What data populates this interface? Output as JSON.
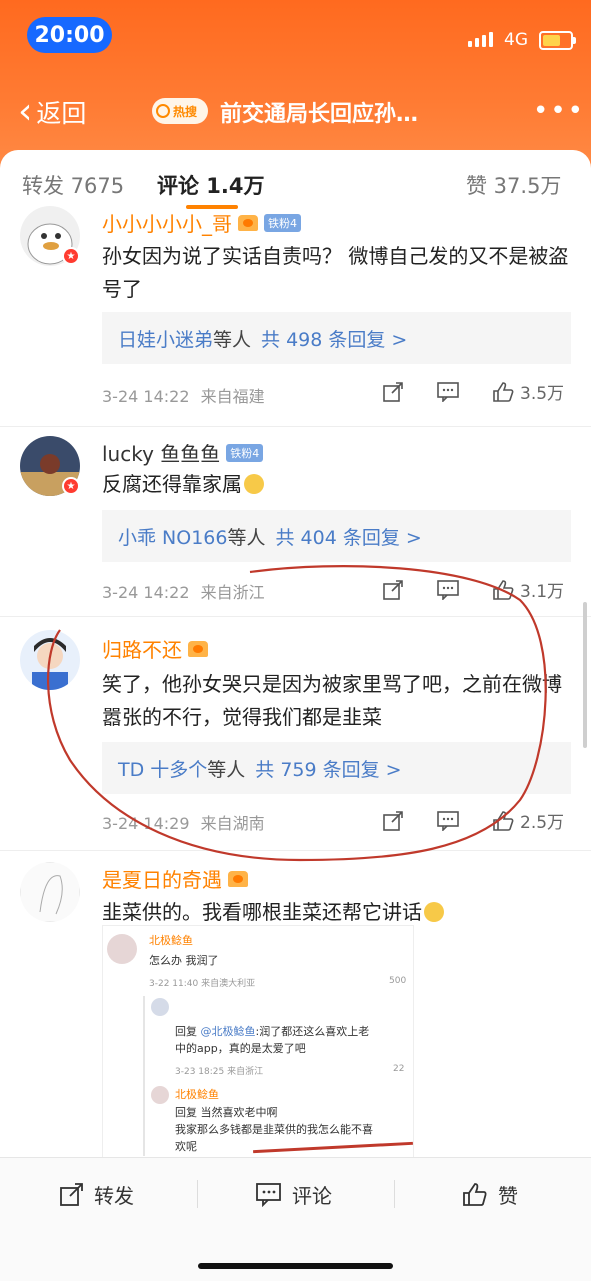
{
  "status": {
    "time": "20:00",
    "network": "4G"
  },
  "nav": {
    "back_label": "返回",
    "hot_badge": "热搜",
    "title": "前交通局长回应孙…"
  },
  "tabs": [
    {
      "label": "转发 7675"
    },
    {
      "label": "评论 1.4万"
    },
    {
      "label": "赞 37.5万"
    }
  ],
  "comments": [
    {
      "username": "小小小小小_哥",
      "fan_badge": "铁粉4",
      "text": "孙女因为说了实话自责吗？ 微博自己发的又不是被盗号了",
      "reply_names": "日娃小迷弟",
      "reply_mid": "等人",
      "reply_count": "共 498 条回复 >",
      "time": "3-24 14:22",
      "location": "来自福建",
      "likes": "3.5万"
    },
    {
      "username": "lucky 鱼鱼鱼",
      "fan_badge": "铁粉4",
      "text": "反腐还得靠家属",
      "reply_names": "小乖 NO166",
      "reply_mid": "等人",
      "reply_count": "共 404 条回复 >",
      "time": "3-24 14:22",
      "location": "来自浙江",
      "likes": "3.1万"
    },
    {
      "username": "归路不还",
      "text": "笑了，他孙女哭只是因为被家里骂了吧，之前在微博嚣张的不行，觉得我们都是韭菜",
      "reply_names": "TD 十多个",
      "reply_mid": "等人",
      "reply_count": "共 759 条回复 >",
      "time": "3-24 14:29",
      "location": "来自湖南",
      "likes": "2.5万"
    },
    {
      "username": "是夏日的奇遇",
      "text": "韭菜供的。我看哪根韭菜还帮它讲话"
    }
  ],
  "embedded": {
    "user1": "北极鲶鱼",
    "line1": "怎么办 我润了",
    "meta1": "3-22 11:40 来自澳大利亚",
    "likes1": "500",
    "reply_prefix": "回复",
    "reply_mention": "@北极鲶鱼",
    "reply_text": ":润了都还这么喜欢上老",
    "reply_text2": "中的app，真的是太爱了吧",
    "meta2": "3-23 18:25 来自浙江",
    "likes2": "22",
    "user2": "北极鲶鱼",
    "line2a": "回复 当然喜欢老中啊",
    "line2b": "我家那么多钱都是韭菜供的我怎么能不喜",
    "line2c": "欢呢"
  },
  "bottom": {
    "repost": "转发",
    "comment": "评论",
    "like": "赞"
  },
  "colors": {
    "accent": "#ff8200",
    "link": "#4a7cc7",
    "annotation": "#c0392b"
  }
}
